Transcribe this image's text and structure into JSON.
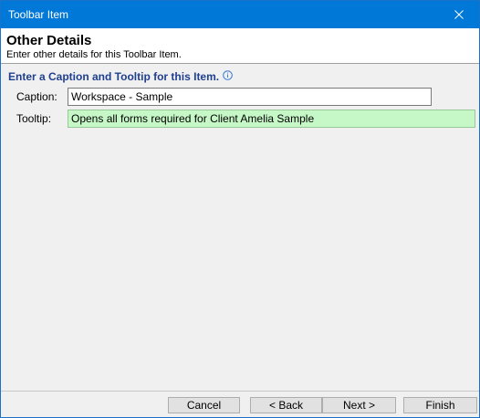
{
  "window": {
    "title": "Toolbar Item"
  },
  "header": {
    "title": "Other Details",
    "subtitle": "Enter other details for this Toolbar Item."
  },
  "section": {
    "title": "Enter a Caption and Tooltip for this Item.",
    "info_icon": "info-icon"
  },
  "fields": {
    "caption": {
      "label": "Caption:",
      "value": "Workspace - Sample"
    },
    "tooltip": {
      "label": "Tooltip:",
      "value": "Opens all forms required for Client Amelia Sample"
    }
  },
  "buttons": {
    "cancel": "Cancel",
    "back": "< Back",
    "next": "Next >",
    "finish": "Finish"
  },
  "colors": {
    "titlebar": "#0078d7",
    "section_title": "#1f3f8f",
    "tooltip_field_bg": "#c6f7c6"
  }
}
